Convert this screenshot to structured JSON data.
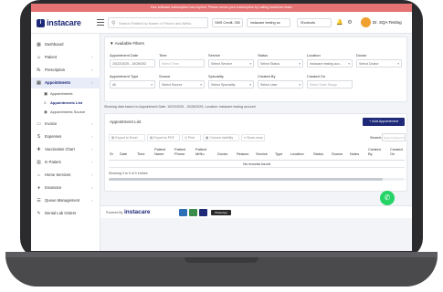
{
  "banner": {
    "text": "Your software subscription has expired. Please renew your subscription by calling InstaCare team."
  },
  "brand": {
    "logo_text": "instacare",
    "logo_mark": "i",
    "accent_color": "#1e2a78",
    "banner_color": "#e57373"
  },
  "topbar": {
    "search_placeholder": "Search Patient by Name or Phone and MrNo",
    "sms_credit": "SMS Credit: 250",
    "location": "instacare testing ac",
    "shortcuts": "Shortcuts",
    "user_name": "Dr. SQA Testing"
  },
  "sidebar": {
    "items": [
      {
        "icon": "dashboard-icon",
        "glyph": "▦",
        "label": "Dashboard",
        "chevron": ""
      },
      {
        "icon": "patient-icon",
        "glyph": "☺",
        "label": "Patient",
        "chevron": "›"
      },
      {
        "icon": "prescription-icon",
        "glyph": "℞",
        "label": "Prescription",
        "chevron": "›"
      },
      {
        "icon": "appointments-icon",
        "glyph": "▤",
        "label": "Appointments",
        "chevron": "›"
      }
    ],
    "sub_items": [
      {
        "icon": "calendar-icon",
        "glyph": "▣",
        "label": "Appointments"
      },
      {
        "icon": "list-icon",
        "glyph": "≡",
        "label": "Appointments List"
      },
      {
        "icon": "source-icon",
        "glyph": "◉",
        "label": "Appointments Source"
      }
    ],
    "lower_items": [
      {
        "icon": "invoice-icon",
        "glyph": "▭",
        "label": "Invoice",
        "chevron": "›"
      },
      {
        "icon": "expenses-icon",
        "glyph": "$",
        "label": "Expenses",
        "chevron": "›"
      },
      {
        "icon": "vaccination-icon",
        "glyph": "✚",
        "label": "Vaccination Chart",
        "chevron": "›"
      },
      {
        "icon": "in-patient-icon",
        "glyph": "▥",
        "label": "In Patient",
        "chevron": "›"
      },
      {
        "icon": "home-services-icon",
        "glyph": "⌂",
        "label": "Home Services",
        "chevron": "›"
      },
      {
        "icon": "insurance-icon",
        "glyph": "♦",
        "label": "Insurance",
        "chevron": "›"
      },
      {
        "icon": "queue-icon",
        "glyph": "☰",
        "label": "Queue Management",
        "chevron": "›"
      },
      {
        "icon": "dental-icon",
        "glyph": "✎",
        "label": "Dental Lab Orders",
        "chevron": ""
      }
    ]
  },
  "filters": {
    "title": "Available Filters",
    "appointment_date": {
      "label": "Appointment Date",
      "value": "10/22/2025 - 10/28/202"
    },
    "time": {
      "label": "Time",
      "placeholder": "Select Time"
    },
    "service": {
      "label": "Service",
      "value": "Select Service"
    },
    "status": {
      "label": "Status",
      "value": "Select Status"
    },
    "location": {
      "label": "Location",
      "value": "instacare testing acc..."
    },
    "doctor": {
      "label": "Doctor",
      "value": "Select Doctor"
    },
    "appointment_type": {
      "label": "Appointment Type",
      "value": "All"
    },
    "source": {
      "label": "Source",
      "value": "Select Source"
    },
    "speciality": {
      "label": "Speciality",
      "value": "Select Speciality"
    },
    "created_by": {
      "label": "Created By",
      "value": "Select User"
    },
    "created_on": {
      "label": "Created On",
      "placeholder": "Select Date Range"
    }
  },
  "showing_text": "Showing data based on Appointment Date: 10/22/2025 - 10/28/2025, Location: instacare testing account",
  "list": {
    "title": "Appointment List",
    "add_button": "+ Add Appointment",
    "export_buttons": [
      "Export to Excel",
      "Export to PDF",
      "Print",
      "Column visibility",
      "Show rows"
    ],
    "search_label": "Search:",
    "search_placeholder": "Search Patient Name, Ph...",
    "columns": [
      "Sr",
      "Date",
      "Time",
      "Patient Name",
      "Patient Phone",
      "Patient MrNo",
      "Doctor",
      "Reason",
      "Service",
      "Type",
      "Location",
      "Status",
      "Source",
      "Notes",
      "Created By",
      "Created On"
    ],
    "empty_text": "No records found",
    "showing_entries": "Showing 0 to 0 of 0 entries"
  },
  "footer": {
    "powered_by": "Powered By",
    "logo_text": "instacare",
    "whatsapp_badge": "WhatsApp"
  }
}
